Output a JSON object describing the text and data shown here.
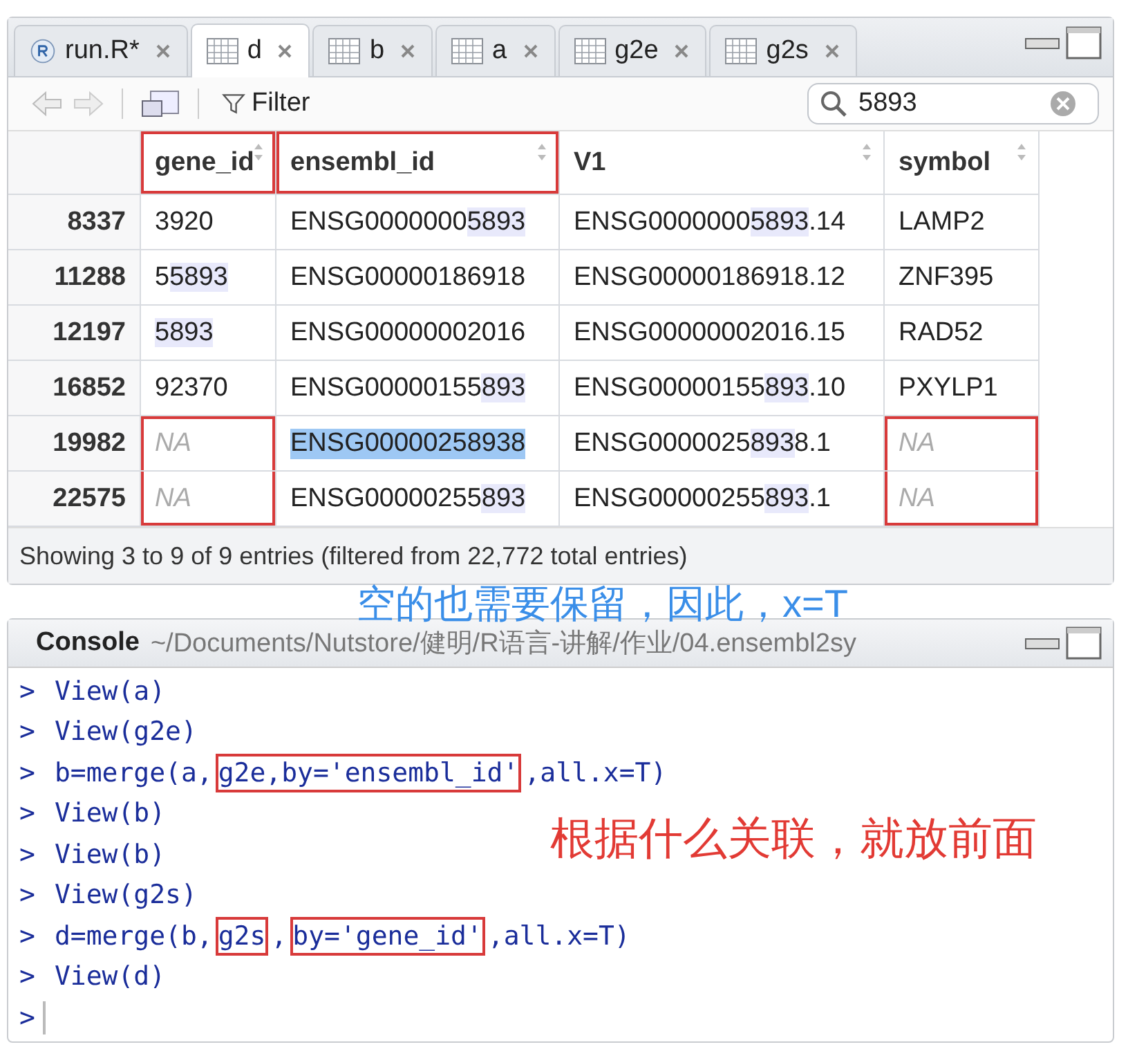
{
  "tabs": [
    {
      "label": "run.R*",
      "kind": "script",
      "selected": false
    },
    {
      "label": "d",
      "kind": "table",
      "selected": true
    },
    {
      "label": "b",
      "kind": "table",
      "selected": false
    },
    {
      "label": "a",
      "kind": "table",
      "selected": false
    },
    {
      "label": "g2e",
      "kind": "table",
      "selected": false
    },
    {
      "label": "g2s",
      "kind": "table",
      "selected": false
    }
  ],
  "toolbar": {
    "filter_label": "Filter",
    "search_value": "5893"
  },
  "table": {
    "columns": [
      {
        "label": "gene_id",
        "boxed": true
      },
      {
        "label": "ensembl_id",
        "boxed": true
      },
      {
        "label": "V1",
        "boxed": false
      },
      {
        "label": "symbol",
        "boxed": false
      }
    ],
    "rows": [
      {
        "row": "8337",
        "cells": [
          {
            "parts": [
              {
                "text": "3920",
                "hit": false
              }
            ],
            "na": false,
            "boxed": false,
            "selected": false
          },
          {
            "parts": [
              {
                "text": "ENSG0000000",
                "hit": false
              },
              {
                "text": "5893",
                "hit": true
              }
            ],
            "na": false,
            "boxed": false,
            "selected": false
          },
          {
            "parts": [
              {
                "text": "ENSG0000000",
                "hit": false
              },
              {
                "text": "5893",
                "hit": true
              },
              {
                "text": ".14",
                "hit": false
              }
            ],
            "na": false,
            "boxed": false,
            "selected": false
          },
          {
            "parts": [
              {
                "text": "LAMP2",
                "hit": false
              }
            ],
            "na": false,
            "boxed": false,
            "selected": false
          }
        ]
      },
      {
        "row": "11288",
        "cells": [
          {
            "parts": [
              {
                "text": "5",
                "hit": false
              },
              {
                "text": "5893",
                "hit": true
              }
            ],
            "na": false,
            "boxed": false,
            "selected": false
          },
          {
            "parts": [
              {
                "text": "ENSG00000186918",
                "hit": false
              }
            ],
            "na": false,
            "boxed": false,
            "selected": false
          },
          {
            "parts": [
              {
                "text": "ENSG00000186918.12",
                "hit": false
              }
            ],
            "na": false,
            "boxed": false,
            "selected": false
          },
          {
            "parts": [
              {
                "text": "ZNF395",
                "hit": false
              }
            ],
            "na": false,
            "boxed": false,
            "selected": false
          }
        ]
      },
      {
        "row": "12197",
        "cells": [
          {
            "parts": [
              {
                "text": "5893",
                "hit": true
              }
            ],
            "na": false,
            "boxed": false,
            "selected": false
          },
          {
            "parts": [
              {
                "text": "ENSG00000002016",
                "hit": false
              }
            ],
            "na": false,
            "boxed": false,
            "selected": false
          },
          {
            "parts": [
              {
                "text": "ENSG00000002016.15",
                "hit": false
              }
            ],
            "na": false,
            "boxed": false,
            "selected": false
          },
          {
            "parts": [
              {
                "text": "RAD52",
                "hit": false
              }
            ],
            "na": false,
            "boxed": false,
            "selected": false
          }
        ]
      },
      {
        "row": "16852",
        "cells": [
          {
            "parts": [
              {
                "text": "92370",
                "hit": false
              }
            ],
            "na": false,
            "boxed": false,
            "selected": false
          },
          {
            "parts": [
              {
                "text": "ENSG00000155",
                "hit": false
              },
              {
                "text": "893",
                "hit": true
              }
            ],
            "na": false,
            "boxed": false,
            "selected": false
          },
          {
            "parts": [
              {
                "text": "ENSG00000155",
                "hit": false
              },
              {
                "text": "893",
                "hit": true
              },
              {
                "text": ".10",
                "hit": false
              }
            ],
            "na": false,
            "boxed": false,
            "selected": false
          },
          {
            "parts": [
              {
                "text": "PXYLP1",
                "hit": false
              }
            ],
            "na": false,
            "boxed": false,
            "selected": false
          }
        ]
      },
      {
        "row": "19982",
        "cells": [
          {
            "parts": [
              {
                "text": "NA",
                "hit": false
              }
            ],
            "na": true,
            "boxed": true,
            "selected": false
          },
          {
            "parts": [
              {
                "text": "ENSG00000258938",
                "hit": false
              }
            ],
            "na": false,
            "boxed": false,
            "selected": true
          },
          {
            "parts": [
              {
                "text": "ENSG0000025",
                "hit": false
              },
              {
                "text": "893",
                "hit": true
              },
              {
                "text": "8.1",
                "hit": false
              }
            ],
            "na": false,
            "boxed": false,
            "selected": false
          },
          {
            "parts": [
              {
                "text": "NA",
                "hit": false
              }
            ],
            "na": true,
            "boxed": true,
            "selected": false
          }
        ]
      },
      {
        "row": "22575",
        "cells": [
          {
            "parts": [
              {
                "text": "NA",
                "hit": false
              }
            ],
            "na": true,
            "boxed": true,
            "selected": false
          },
          {
            "parts": [
              {
                "text": "ENSG00000255",
                "hit": false
              },
              {
                "text": "893",
                "hit": true
              }
            ],
            "na": false,
            "boxed": false,
            "selected": false
          },
          {
            "parts": [
              {
                "text": "ENSG00000255",
                "hit": false
              },
              {
                "text": "893",
                "hit": true
              },
              {
                "text": ".1",
                "hit": false
              }
            ],
            "na": false,
            "boxed": false,
            "selected": false
          },
          {
            "parts": [
              {
                "text": "NA",
                "hit": false
              }
            ],
            "na": true,
            "boxed": true,
            "selected": false
          }
        ]
      }
    ],
    "footer": "Showing 3 to 9 of 9 entries (filtered from 22,772 total entries)"
  },
  "note_top": "空的也需要保留，因此，x=T",
  "console": {
    "title": "Console",
    "path": "~/Documents/Nutstore/健明/R语言-讲解/作业/04.ensembl2sy",
    "lines": [
      {
        "prompt": ">",
        "parts": [
          {
            "text": "View(a)",
            "boxed": false
          }
        ]
      },
      {
        "prompt": ">",
        "parts": [
          {
            "text": "View(g2e)",
            "boxed": false
          }
        ]
      },
      {
        "prompt": ">",
        "parts": [
          {
            "text": "b=merge(a,",
            "boxed": false
          },
          {
            "text": "g2e,by='ensembl_id'",
            "boxed": true
          },
          {
            "text": ",all.x=T)",
            "boxed": false
          }
        ]
      },
      {
        "prompt": ">",
        "parts": [
          {
            "text": "View(b)",
            "boxed": false
          }
        ]
      },
      {
        "prompt": ">",
        "parts": [
          {
            "text": "View(b)",
            "boxed": false
          }
        ]
      },
      {
        "prompt": ">",
        "parts": [
          {
            "text": "View(g2s)",
            "boxed": false
          }
        ]
      },
      {
        "prompt": ">",
        "parts": [
          {
            "text": "d=merge(b,",
            "boxed": false
          },
          {
            "text": "g2s",
            "boxed": true
          },
          {
            "text": ",",
            "boxed": false
          },
          {
            "text": "by='gene_id'",
            "boxed": true
          },
          {
            "text": ",all.x=T)",
            "boxed": false
          }
        ]
      },
      {
        "prompt": ">",
        "parts": [
          {
            "text": "View(d)",
            "boxed": false
          }
        ]
      },
      {
        "prompt": ">"
      }
    ],
    "note": "根据什么关联，就放前面"
  }
}
